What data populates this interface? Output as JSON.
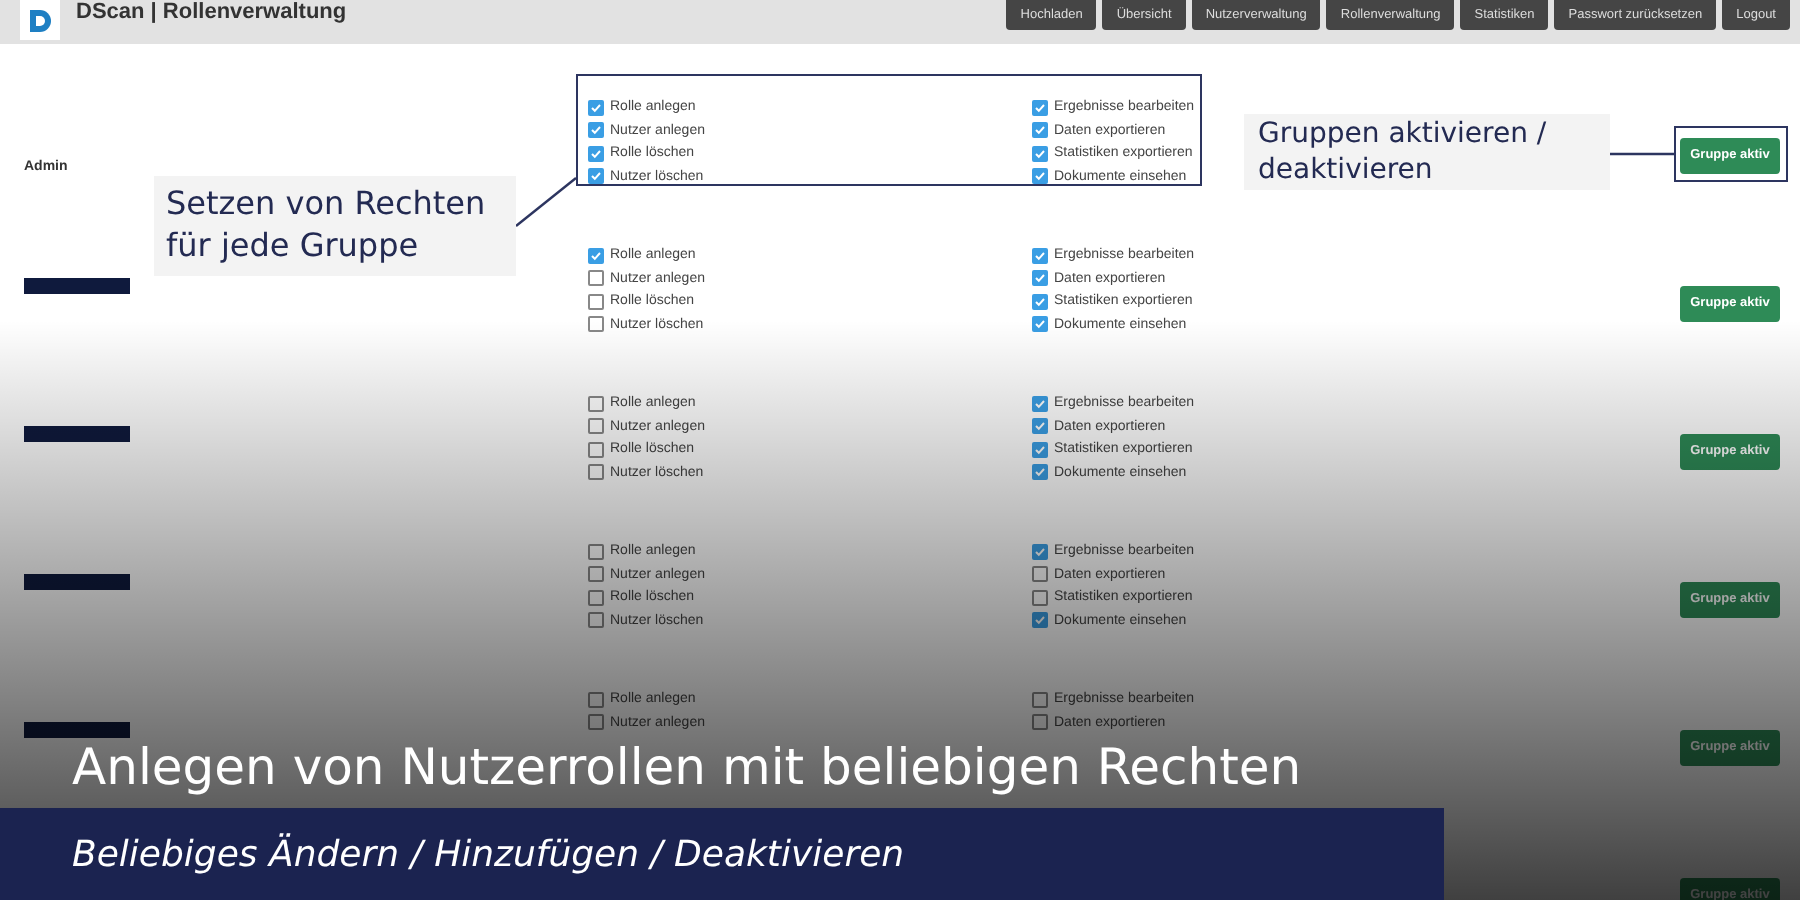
{
  "app": {
    "title": "DScan | Rollenverwaltung"
  },
  "nav": [
    "Hochladen",
    "Übersicht",
    "Nutzerverwaltung",
    "Rollenverwaltung",
    "Statistiken",
    "Passwort zurücksetzen",
    "Logout"
  ],
  "groups": [
    {
      "kind": "named",
      "name": "Admin",
      "left": [
        {
          "label": "Rolle anlegen",
          "checked": true
        },
        {
          "label": "Nutzer anlegen",
          "checked": true
        },
        {
          "label": "Rolle löschen",
          "checked": true
        },
        {
          "label": "Nutzer löschen",
          "checked": true
        }
      ],
      "right": [
        {
          "label": "Ergebnisse bearbeiten",
          "checked": true
        },
        {
          "label": "Daten exportieren",
          "checked": true
        },
        {
          "label": "Statistiken exportieren",
          "checked": true
        },
        {
          "label": "Dokumente einsehen",
          "checked": true
        }
      ],
      "button": "Gruppe aktiv"
    },
    {
      "kind": "redacted",
      "left": [
        {
          "label": "Rolle anlegen",
          "checked": true
        },
        {
          "label": "Nutzer anlegen",
          "checked": false
        },
        {
          "label": "Rolle löschen",
          "checked": false
        },
        {
          "label": "Nutzer löschen",
          "checked": false
        }
      ],
      "right": [
        {
          "label": "Ergebnisse bearbeiten",
          "checked": true
        },
        {
          "label": "Daten exportieren",
          "checked": true
        },
        {
          "label": "Statistiken exportieren",
          "checked": true
        },
        {
          "label": "Dokumente einsehen",
          "checked": true
        }
      ],
      "button": "Gruppe aktiv"
    },
    {
      "kind": "redacted",
      "left": [
        {
          "label": "Rolle anlegen",
          "checked": false
        },
        {
          "label": "Nutzer anlegen",
          "checked": false
        },
        {
          "label": "Rolle löschen",
          "checked": false
        },
        {
          "label": "Nutzer löschen",
          "checked": false
        }
      ],
      "right": [
        {
          "label": "Ergebnisse bearbeiten",
          "checked": true
        },
        {
          "label": "Daten exportieren",
          "checked": true
        },
        {
          "label": "Statistiken exportieren",
          "checked": true
        },
        {
          "label": "Dokumente einsehen",
          "checked": true
        }
      ],
      "button": "Gruppe aktiv"
    },
    {
      "kind": "redacted",
      "left": [
        {
          "label": "Rolle anlegen",
          "checked": false
        },
        {
          "label": "Nutzer anlegen",
          "checked": false
        },
        {
          "label": "Rolle löschen",
          "checked": false
        },
        {
          "label": "Nutzer löschen",
          "checked": false
        }
      ],
      "right": [
        {
          "label": "Ergebnisse bearbeiten",
          "checked": true
        },
        {
          "label": "Daten exportieren",
          "checked": false
        },
        {
          "label": "Statistiken exportieren",
          "checked": false
        },
        {
          "label": "Dokumente einsehen",
          "checked": true
        }
      ],
      "button": "Gruppe aktiv"
    },
    {
      "kind": "redacted",
      "left": [
        {
          "label": "Rolle anlegen",
          "checked": false
        },
        {
          "label": "Nutzer anlegen",
          "checked": false
        }
      ],
      "right": [
        {
          "label": "Ergebnisse bearbeiten",
          "checked": false
        },
        {
          "label": "Daten exportieren",
          "checked": false
        }
      ],
      "button": "Gruppe aktiv"
    },
    {
      "kind": "button_only",
      "button": "Gruppe aktiv"
    }
  ],
  "annotations": [
    {
      "text": "Setzen von Rechten für jede Gruppe"
    },
    {
      "text": "Gruppen aktivieren / deaktivieren"
    }
  ],
  "caption": {
    "title": "Anlegen von Nutzerrollen mit beliebigen Rechten",
    "subtitle": "Beliebiges Ändern / Hinzufügen / Deaktivieren"
  }
}
